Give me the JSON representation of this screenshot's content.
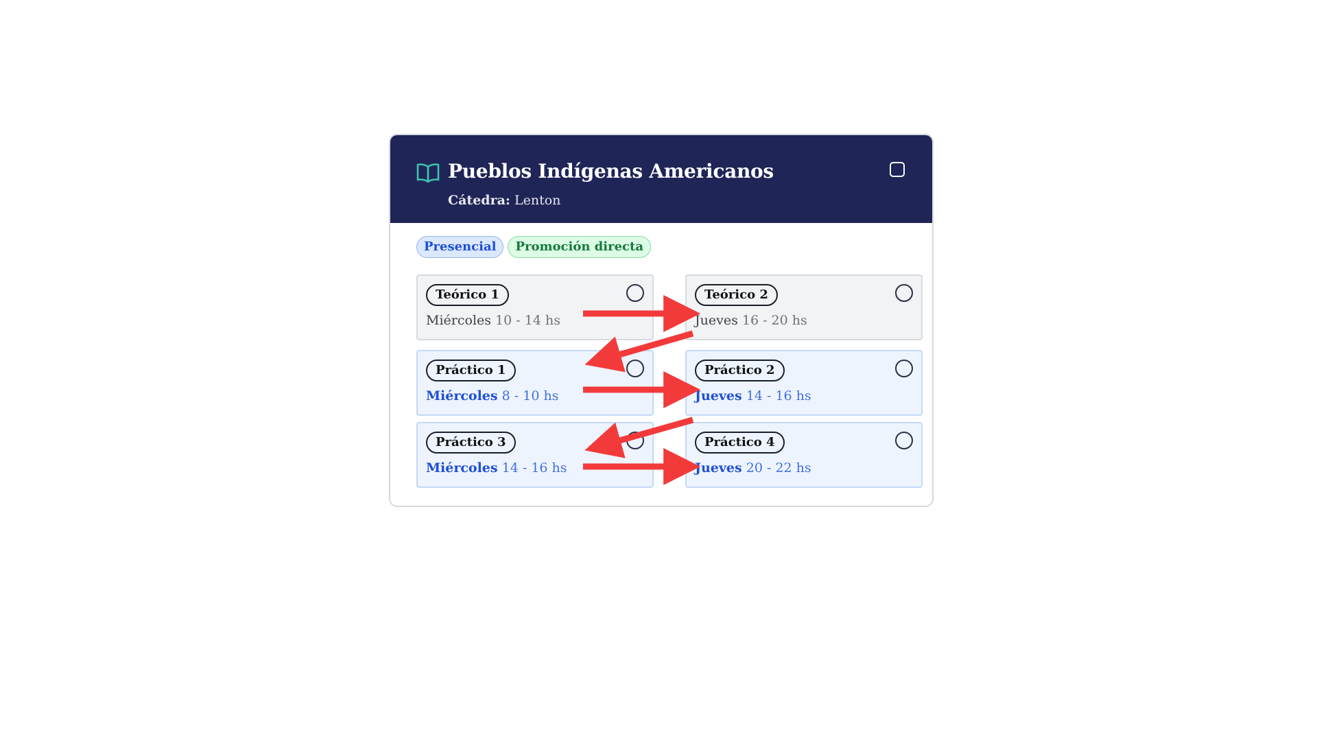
{
  "course": {
    "title": "Pueblos Indígenas Americanos",
    "catedra_label": "Cátedra:",
    "catedra_value": "Lenton",
    "icon": "open-book-icon"
  },
  "tags": [
    {
      "label": "Presencial",
      "color": "#1d4fd8"
    },
    {
      "label": "Promoción directa",
      "color": "#16793c"
    }
  ],
  "slots": [
    {
      "name": "Teórico 1",
      "day": "Miércoles",
      "hours": "10 - 14 hs",
      "kind": "teorico"
    },
    {
      "name": "Teórico 2",
      "day": "Jueves",
      "hours": "16 - 20 hs",
      "kind": "teorico"
    },
    {
      "name": "Práctico 1",
      "day": "Miércoles",
      "hours": "8 - 10 hs",
      "kind": "practico"
    },
    {
      "name": "Práctico 2",
      "day": "Jueves",
      "hours": "14 - 16 hs",
      "kind": "practico"
    },
    {
      "name": "Práctico 3",
      "day": "Miércoles",
      "hours": "14 - 16 hs",
      "kind": "practico"
    },
    {
      "name": "Práctico 4",
      "day": "Jueves",
      "hours": "20 - 22 hs",
      "kind": "practico"
    }
  ],
  "colors": {
    "header_bg": "#1f2556",
    "icon_teal": "#3fc1b0",
    "arrow_red": "#f23a3a"
  }
}
